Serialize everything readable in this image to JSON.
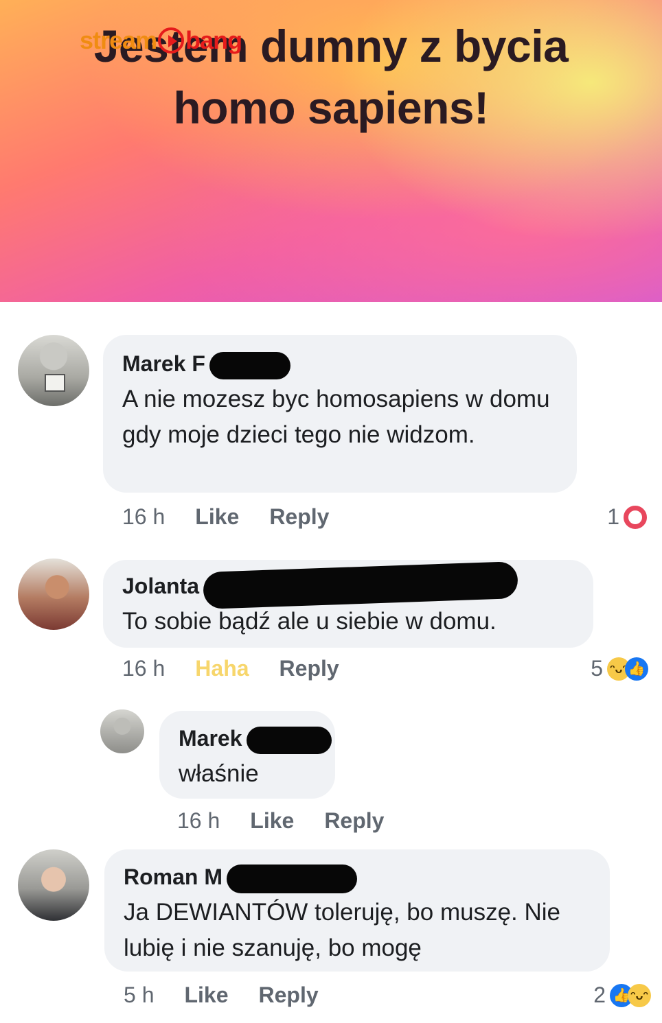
{
  "post": {
    "title": "Jestem dumny z bycia homo sapiens!",
    "watermark": {
      "part1": "stream",
      "part2": "bang"
    }
  },
  "comments": [
    {
      "author": "Marek F",
      "text": "A nie mozesz byc homosapiens w domu gdy moje dzieci tego nie widzom.",
      "time": "16 h",
      "action1": "Like",
      "action2": "Reply",
      "reaction_count": "1",
      "reactions": [
        "heart-icon"
      ]
    },
    {
      "author": "Jolanta",
      "text": "To sobie bądź ale u siebie w domu.",
      "time": "16 h",
      "action1": "Haha",
      "action2": "Reply",
      "reaction_count": "5",
      "reactions": [
        "haha-icon",
        "like-icon"
      ]
    },
    {
      "author": "Marek",
      "text": "właśnie",
      "time": "16 h",
      "action1": "Like",
      "action2": "Reply"
    },
    {
      "author": "Roman M",
      "text": "Ja DEWIANTÓW toleruję, bo muszę. Nie lubię i nie szanuję, bo mogę",
      "time": "5 h",
      "action1": "Like",
      "action2": "Reply",
      "reaction_count": "2",
      "reactions": [
        "like-icon",
        "haha-icon"
      ]
    }
  ],
  "colors": {
    "bubble": "#f0f2f5",
    "text": "#1c1e21",
    "meta": "#606770",
    "haha": "#f7d66c"
  }
}
